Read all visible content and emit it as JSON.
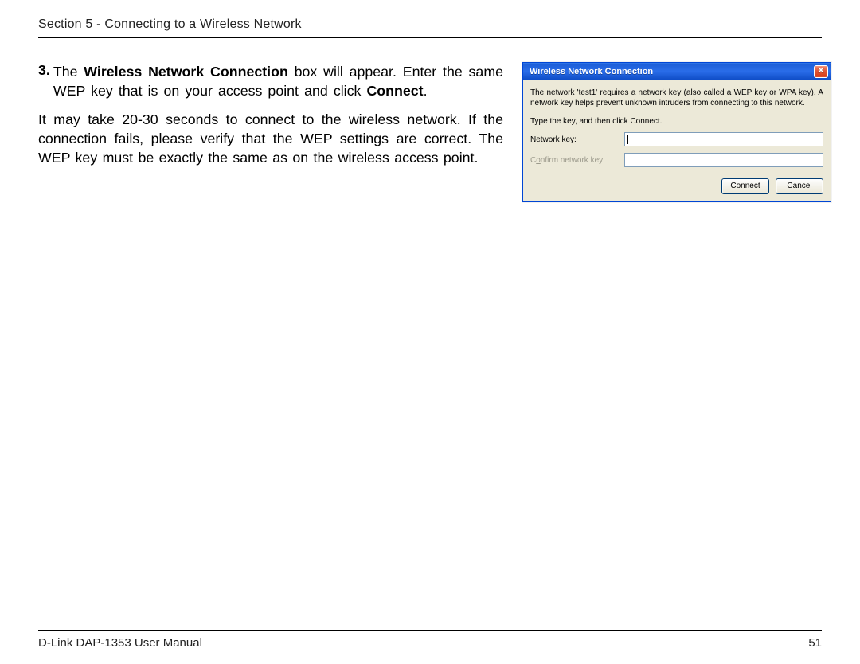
{
  "header": {
    "section_title": "Section 5 - Connecting to a Wireless Network"
  },
  "body": {
    "step_number": "3.",
    "step_line1_pre": "The ",
    "step_line1_bold": "Wireless Network Connection",
    "step_line1_post": " box will appear. Enter the same WEP key that is on your access point and click ",
    "step_line1_bold2": "Connect",
    "step_line1_end": ".",
    "paragraph2": "It may take 20-30 seconds to connect to the wireless network. If the connection fails, please verify that the WEP settings are correct. The WEP key must be exactly the same as on the wireless access point."
  },
  "dialog": {
    "title": "Wireless Network Connection",
    "description": "The network 'test1' requires a network key (also called a WEP key or WPA key). A network key helps prevent unknown intruders from connecting to this network.",
    "instruction": "Type the key, and then click Connect.",
    "network_key_label_pre": "Network ",
    "network_key_label_u": "k",
    "network_key_label_post": "ey:",
    "confirm_label_pre": "C",
    "confirm_label_u": "o",
    "confirm_label_post": "nfirm network key:",
    "connect_btn_u": "C",
    "connect_btn_post": "onnect",
    "cancel_btn": "Cancel",
    "network_key_value": "",
    "confirm_key_value": ""
  },
  "footer": {
    "manual_title": "D-Link DAP-1353 User Manual",
    "page_number": "51"
  }
}
